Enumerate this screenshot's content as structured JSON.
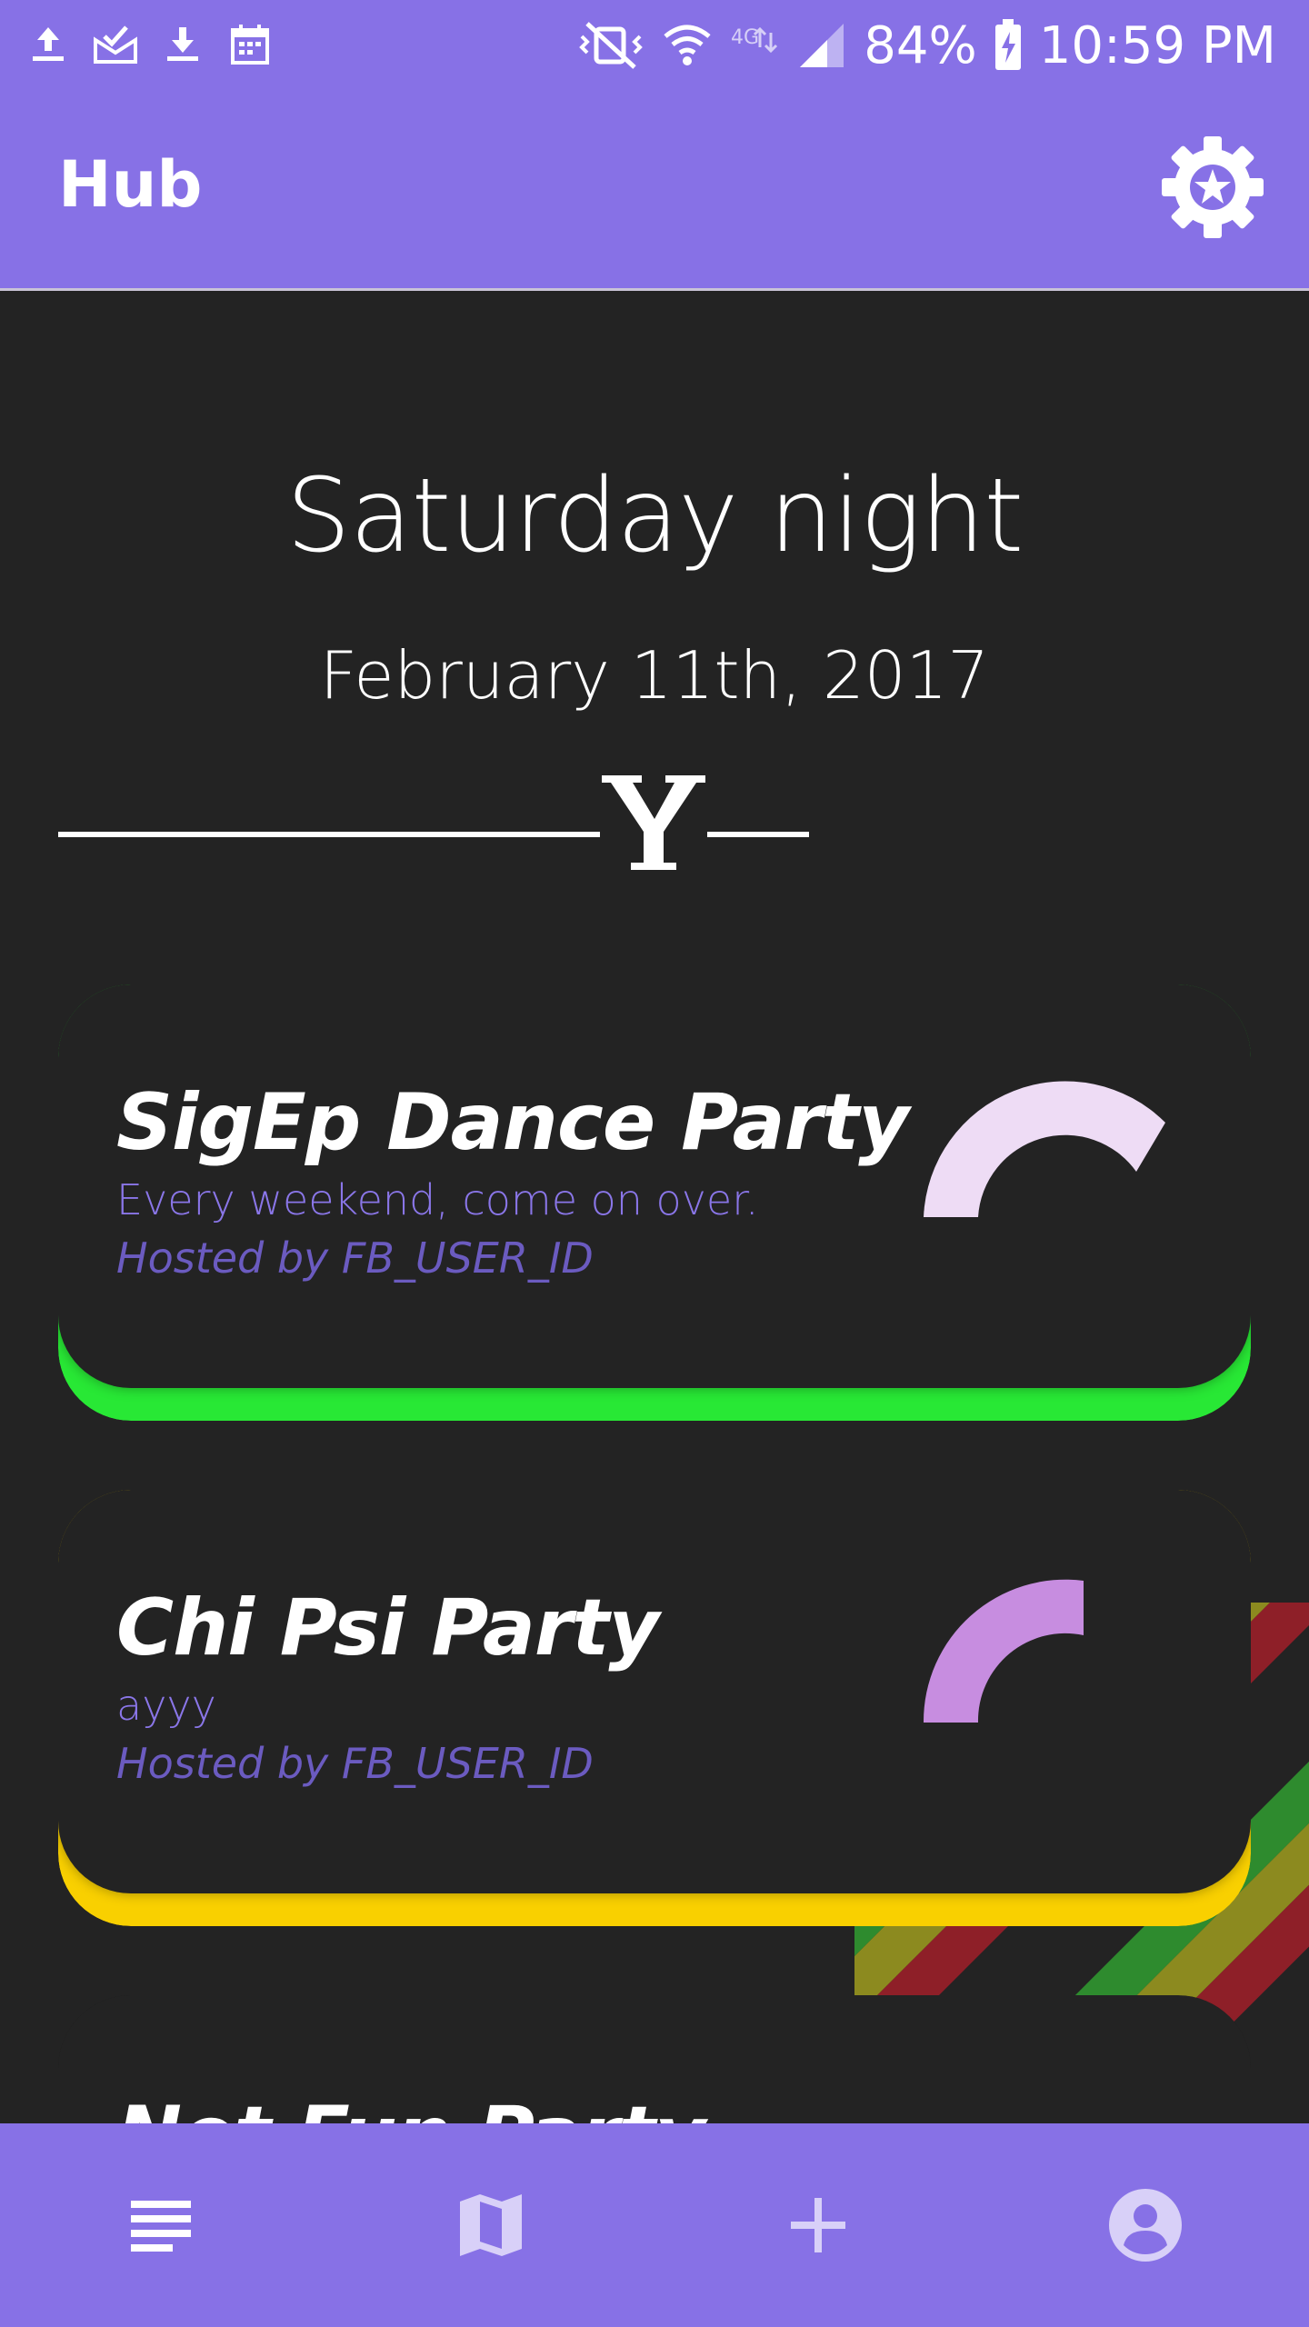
{
  "status_bar": {
    "battery": "84%",
    "time": "10:59 PM",
    "icons": [
      "upload-icon",
      "mail-done-icon",
      "download-icon",
      "calendar-icon",
      "vibrate-mute-icon",
      "wifi-icon",
      "lte-icon",
      "signal-icon",
      "battery-charging-icon"
    ]
  },
  "app_bar": {
    "title": "Hub",
    "settings_icon": "gear-icon"
  },
  "hub": {
    "day_title": "Saturday night",
    "date": "February 11th, 2017",
    "divider_icon": "yale-y-logo"
  },
  "events": [
    {
      "title": "SigEp Dance Party",
      "description": "Every weekend, come on over.",
      "host": "Hosted by FB_USER_ID",
      "accent_color": "#28e835",
      "gauge_color": "#eedcf5",
      "gauge_level": 0.35
    },
    {
      "title": "Chi Psi Party",
      "description": "ayyy",
      "host": "Hosted by FB_USER_ID",
      "accent_color": "#f9d000",
      "gauge_color": "#c78de0",
      "gauge_level": 0.5
    },
    {
      "title": "Not Fun Party",
      "accent_color": "#cc2222"
    }
  ],
  "bottom_nav": {
    "items": [
      {
        "icon": "list-icon"
      },
      {
        "icon": "map-icon"
      },
      {
        "icon": "add-icon"
      },
      {
        "icon": "profile-icon"
      }
    ]
  },
  "colors": {
    "primary": "#8771e6",
    "background": "#232323",
    "desc_text": "#8a76e8",
    "host_text": "#6b5bc0"
  }
}
